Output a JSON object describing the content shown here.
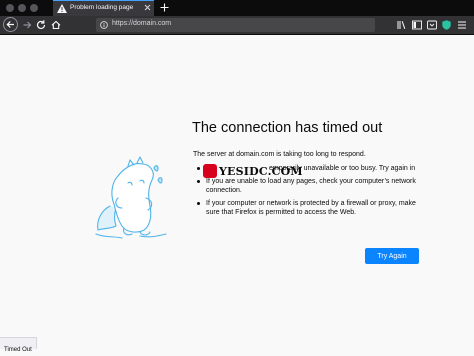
{
  "browser": {
    "tab": {
      "title": "Problem loading page",
      "icon": "warning-icon"
    },
    "new_tab_icon": "plus-icon",
    "url": "https://domain.com",
    "colors": {
      "tab_accent": "#45a1ff",
      "tracking_shield": "#2ac3a2"
    }
  },
  "error_page": {
    "title": "The connection has timed out",
    "lead": "The server at domain.com is taking too long to respond.",
    "bullets": [
      "The site could be temporarily unavailable or too busy. Try again in a few moments.",
      "If you are unable to load any pages, check your computer’s network connection.",
      "If your computer or network is protected by a firewall or proxy, make sure that Firefox is permitted to access the Web."
    ],
    "visible_bullet_1": "emporarily unavailable or too busy. Try again in",
    "try_again_label": "Try Again",
    "button_color": "#0a84ff"
  },
  "watermark": {
    "text": "YESIDC.COM"
  },
  "status": {
    "text": "Timed Out"
  }
}
